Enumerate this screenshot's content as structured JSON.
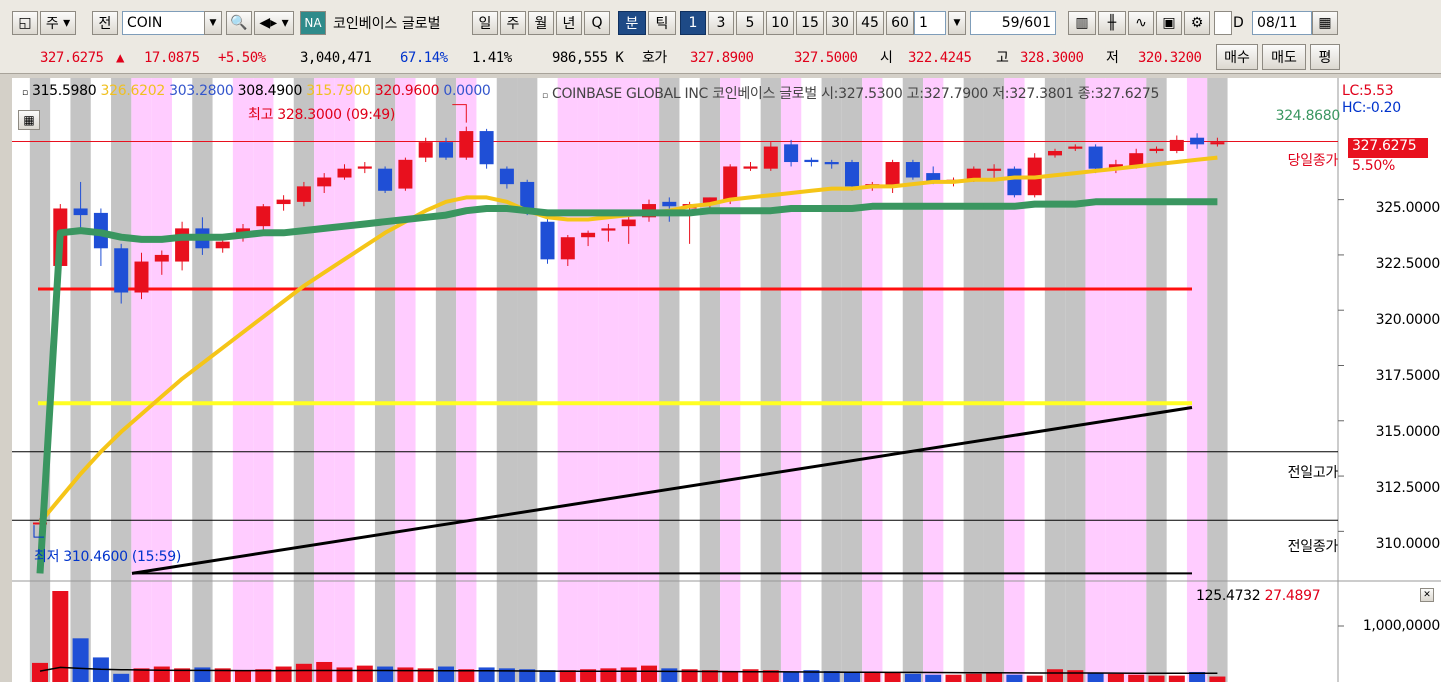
{
  "toolbar": {
    "market": "주",
    "prev": "전",
    "symbol": "COIN",
    "na_badge": "NA",
    "stock_name": "코인베이스 글로벌",
    "periods": [
      "일",
      "주",
      "월",
      "년",
      "Q",
      "분",
      "틱"
    ],
    "intervals": [
      "1",
      "3",
      "5",
      "10",
      "15",
      "30",
      "45",
      "60"
    ],
    "multiplier": "1",
    "page": "59/601",
    "date_value": "08/11",
    "date_check_label": "D"
  },
  "quote": {
    "price": "327.6275",
    "arrow": "▲",
    "change": "17.0875",
    "pct": "+5.50%",
    "volume": "3,040,471",
    "vol_ratio": "67.14%",
    "turnover": "1.41%",
    "amount": "986,555 K",
    "ask_label": "호가",
    "ask": "327.8900",
    "bid": "327.5000",
    "open_label": "시",
    "open": "322.4245",
    "high_label": "고",
    "high": "328.3000",
    "low_label": "저",
    "low": "320.3200",
    "buy_label": "매수",
    "sell_label": "매도",
    "avg_label": "평"
  },
  "legend": {
    "ma": [
      {
        "v": "315.5980",
        "color": "#000000"
      },
      {
        "v": "326.6202",
        "color": "#f0c020"
      },
      {
        "v": "303.2800",
        "color": "#3355cc"
      },
      {
        "v": "308.4900",
        "color": "#000000"
      },
      {
        "v": "315.7900",
        "color": "#f0c020"
      },
      {
        "v": "320.9600",
        "color": "#e0001a"
      },
      {
        "v": "0.0000",
        "color": "#3355cc"
      }
    ],
    "title": "COINBASE GLOBAL INC  코인베이스 글로벌 시:327.5300 고:327.7900 저:327.3801 종:327.6275",
    "lc": "LC:5.53",
    "hc": "HC:-0.20"
  },
  "annotations": {
    "max": "최고 328.3000 (09:49)",
    "min": "최저 310.4600 (15:59)",
    "today_close": "당일종가",
    "today_close_pct": "5.50%",
    "prev_high": "전일고가",
    "prev_close": "전일종가",
    "green_level": "324.8680",
    "current_price": "327.6275",
    "vol_info": "125.4732",
    "vol_info2": "27.4897"
  },
  "colors": {
    "up": "#e8101e",
    "down": "#1f4fd6",
    "pink": "#ffccff",
    "gray": "#c4c4c4",
    "ma_green": "#3a9660",
    "ma_yellow": "#f5c518",
    "level_red": "#ff1010",
    "level_yellow": "#ffff22"
  },
  "chart_data": {
    "type": "candlestick",
    "ylim": [
      307.8,
      330.5
    ],
    "yticks": [
      "325.0000",
      "322.5000",
      "320.0000",
      "317.5000",
      "315.0000",
      "312.5000",
      "310.0000"
    ],
    "candles": [
      {
        "o": 310.4,
        "h": 310.6,
        "l": 309.8,
        "c": 310.4
      },
      {
        "o": 322.0,
        "h": 324.8,
        "l": 321.8,
        "c": 324.6
      },
      {
        "o": 324.6,
        "h": 325.8,
        "l": 323.5,
        "c": 324.3
      },
      {
        "o": 324.4,
        "h": 324.6,
        "l": 322.0,
        "c": 322.8
      },
      {
        "o": 322.8,
        "h": 323.0,
        "l": 320.3,
        "c": 320.8
      },
      {
        "o": 320.8,
        "h": 322.6,
        "l": 320.5,
        "c": 322.2
      },
      {
        "o": 322.2,
        "h": 322.7,
        "l": 321.6,
        "c": 322.5
      },
      {
        "o": 322.2,
        "h": 324.0,
        "l": 321.8,
        "c": 323.7
      },
      {
        "o": 323.7,
        "h": 324.2,
        "l": 322.5,
        "c": 322.8
      },
      {
        "o": 322.8,
        "h": 323.4,
        "l": 322.6,
        "c": 323.1
      },
      {
        "o": 323.3,
        "h": 323.9,
        "l": 323.1,
        "c": 323.7
      },
      {
        "o": 323.8,
        "h": 324.8,
        "l": 323.6,
        "c": 324.7
      },
      {
        "o": 324.8,
        "h": 325.2,
        "l": 324.5,
        "c": 325.0
      },
      {
        "o": 324.9,
        "h": 325.8,
        "l": 324.7,
        "c": 325.6
      },
      {
        "o": 325.6,
        "h": 326.2,
        "l": 325.3,
        "c": 326.0
      },
      {
        "o": 326.0,
        "h": 326.6,
        "l": 325.9,
        "c": 326.4
      },
      {
        "o": 326.4,
        "h": 326.7,
        "l": 326.2,
        "c": 326.5
      },
      {
        "o": 326.4,
        "h": 326.5,
        "l": 325.3,
        "c": 325.4
      },
      {
        "o": 325.5,
        "h": 326.9,
        "l": 325.4,
        "c": 326.8
      },
      {
        "o": 326.9,
        "h": 327.8,
        "l": 326.7,
        "c": 327.6
      },
      {
        "o": 327.6,
        "h": 327.8,
        "l": 326.8,
        "c": 326.9
      },
      {
        "o": 326.9,
        "h": 328.3,
        "l": 326.8,
        "c": 328.1
      },
      {
        "o": 328.1,
        "h": 328.2,
        "l": 326.4,
        "c": 326.6
      },
      {
        "o": 326.4,
        "h": 326.5,
        "l": 325.5,
        "c": 325.7
      },
      {
        "o": 325.8,
        "h": 325.9,
        "l": 324.3,
        "c": 324.5
      },
      {
        "o": 324.0,
        "h": 324.2,
        "l": 322.1,
        "c": 322.3
      },
      {
        "o": 322.3,
        "h": 323.4,
        "l": 322.0,
        "c": 323.3
      },
      {
        "o": 323.3,
        "h": 323.6,
        "l": 322.9,
        "c": 323.5
      },
      {
        "o": 323.6,
        "h": 323.9,
        "l": 323.1,
        "c": 323.7
      },
      {
        "o": 323.8,
        "h": 324.3,
        "l": 323.0,
        "c": 324.1
      },
      {
        "o": 324.2,
        "h": 325.0,
        "l": 324.0,
        "c": 324.8
      },
      {
        "o": 324.9,
        "h": 325.1,
        "l": 324.0,
        "c": 324.7
      },
      {
        "o": 324.6,
        "h": 324.9,
        "l": 323.0,
        "c": 324.8
      },
      {
        "o": 324.8,
        "h": 325.1,
        "l": 324.6,
        "c": 325.1
      },
      {
        "o": 325.0,
        "h": 326.6,
        "l": 324.8,
        "c": 326.5
      },
      {
        "o": 326.4,
        "h": 326.7,
        "l": 326.3,
        "c": 326.5
      },
      {
        "o": 326.4,
        "h": 327.6,
        "l": 326.3,
        "c": 327.4
      },
      {
        "o": 327.5,
        "h": 327.7,
        "l": 326.5,
        "c": 326.7
      },
      {
        "o": 326.8,
        "h": 326.9,
        "l": 326.5,
        "c": 326.7
      },
      {
        "o": 326.7,
        "h": 326.8,
        "l": 326.4,
        "c": 326.6
      },
      {
        "o": 326.7,
        "h": 326.8,
        "l": 325.4,
        "c": 325.6
      },
      {
        "o": 325.6,
        "h": 325.8,
        "l": 325.4,
        "c": 325.7
      },
      {
        "o": 325.6,
        "h": 326.8,
        "l": 325.3,
        "c": 326.7
      },
      {
        "o": 326.7,
        "h": 326.8,
        "l": 325.9,
        "c": 326.0
      },
      {
        "o": 326.2,
        "h": 326.5,
        "l": 325.7,
        "c": 325.8
      },
      {
        "o": 325.8,
        "h": 326.0,
        "l": 325.6,
        "c": 325.9
      },
      {
        "o": 325.9,
        "h": 326.5,
        "l": 325.8,
        "c": 326.4
      },
      {
        "o": 326.3,
        "h": 326.6,
        "l": 325.9,
        "c": 326.4
      },
      {
        "o": 326.4,
        "h": 326.5,
        "l": 325.1,
        "c": 325.2
      },
      {
        "o": 325.2,
        "h": 327.1,
        "l": 325.1,
        "c": 326.9
      },
      {
        "o": 327.0,
        "h": 327.3,
        "l": 326.9,
        "c": 327.2
      },
      {
        "o": 327.3,
        "h": 327.5,
        "l": 327.2,
        "c": 327.4
      },
      {
        "o": 327.4,
        "h": 327.5,
        "l": 326.2,
        "c": 326.4
      },
      {
        "o": 326.4,
        "h": 326.8,
        "l": 326.2,
        "c": 326.6
      },
      {
        "o": 326.5,
        "h": 327.3,
        "l": 326.4,
        "c": 327.1
      },
      {
        "o": 327.2,
        "h": 327.4,
        "l": 327.1,
        "c": 327.3
      },
      {
        "o": 327.2,
        "h": 327.9,
        "l": 327.1,
        "c": 327.7
      },
      {
        "o": 327.8,
        "h": 328.0,
        "l": 327.3,
        "c": 327.5
      },
      {
        "o": 327.5,
        "h": 327.8,
        "l": 327.4,
        "c": 327.6
      }
    ],
    "bands": [
      "gray",
      "none",
      "gray",
      "none",
      "gray",
      "pink",
      "pink",
      "none",
      "gray",
      "none",
      "pink",
      "pink",
      "none",
      "gray",
      "pink",
      "pink",
      "none",
      "gray",
      "pink",
      "none",
      "gray",
      "pink",
      "none",
      "gray",
      "gray",
      "none",
      "pink",
      "pink",
      "pink",
      "pink",
      "pink",
      "gray",
      "none",
      "gray",
      "pink",
      "none",
      "gray",
      "pink",
      "none",
      "gray",
      "gray",
      "pink",
      "none",
      "gray",
      "pink",
      "none",
      "gray",
      "gray",
      "pink",
      "none",
      "gray",
      "gray",
      "pink",
      "pink",
      "pink",
      "gray",
      "none",
      "pink",
      "gray"
    ],
    "ma_yellow": [
      310.4,
      311.5,
      312.6,
      313.6,
      314.5,
      315.3,
      316.1,
      316.9,
      317.6,
      318.3,
      319.0,
      319.7,
      320.4,
      321.1,
      321.7,
      322.3,
      322.9,
      323.5,
      324.0,
      324.5,
      324.9,
      325.1,
      325.1,
      324.9,
      324.5,
      324.2,
      324.1,
      324.1,
      324.2,
      324.3,
      324.4,
      324.5,
      324.7,
      324.8,
      325.0,
      325.1,
      325.2,
      325.3,
      325.4,
      325.5,
      325.5,
      325.6,
      325.6,
      325.7,
      325.8,
      325.8,
      325.9,
      325.9,
      326.0,
      326.0,
      326.1,
      326.2,
      326.3,
      326.4,
      326.5,
      326.6,
      326.7,
      326.8,
      326.9
    ],
    "ma_green": [
      308.1,
      323.5,
      323.6,
      323.5,
      323.3,
      323.2,
      323.2,
      323.3,
      323.3,
      323.3,
      323.4,
      323.5,
      323.5,
      323.6,
      323.7,
      323.8,
      323.9,
      324.0,
      324.1,
      324.2,
      324.3,
      324.5,
      324.6,
      324.6,
      324.5,
      324.4,
      324.4,
      324.4,
      324.4,
      324.4,
      324.4,
      324.4,
      324.4,
      324.5,
      324.5,
      324.5,
      324.5,
      324.6,
      324.6,
      324.6,
      324.6,
      324.7,
      324.7,
      324.7,
      324.7,
      324.7,
      324.7,
      324.7,
      324.7,
      324.8,
      324.8,
      324.8,
      324.9,
      324.9,
      324.9,
      324.9,
      324.9,
      324.9,
      324.9
    ],
    "levels": {
      "red": 320.96,
      "yellow": 315.79,
      "prev_high": 313.6,
      "prev_close": 310.5,
      "low_line": 308.1
    },
    "black_line": {
      "start": 308.1,
      "end": 315.6
    },
    "volumes": [
      210,
      1000,
      480,
      270,
      90,
      150,
      170,
      150,
      160,
      150,
      130,
      140,
      170,
      200,
      220,
      160,
      180,
      170,
      160,
      150,
      170,
      140,
      160,
      150,
      140,
      130,
      130,
      140,
      150,
      160,
      180,
      150,
      140,
      130,
      120,
      140,
      130,
      110,
      130,
      120,
      110,
      100,
      110,
      90,
      80,
      80,
      90,
      100,
      80,
      70,
      140,
      130,
      100,
      90,
      80,
      70,
      70,
      110,
      60
    ],
    "volume_ma": [
      120,
      160,
      150,
      140,
      135,
      132,
      130,
      128,
      127,
      126,
      125,
      125,
      125,
      126,
      126,
      126,
      126,
      126,
      125,
      125,
      124,
      124,
      123,
      122,
      121,
      120,
      119,
      118,
      118,
      118,
      118,
      117,
      116,
      115,
      114,
      113,
      112,
      111,
      110,
      109,
      108,
      107,
      106,
      105,
      104,
      103,
      102,
      101,
      100,
      99,
      99,
      99,
      99,
      98,
      97,
      96,
      96,
      96,
      96
    ],
    "volume_tick": "1,000,0000"
  }
}
